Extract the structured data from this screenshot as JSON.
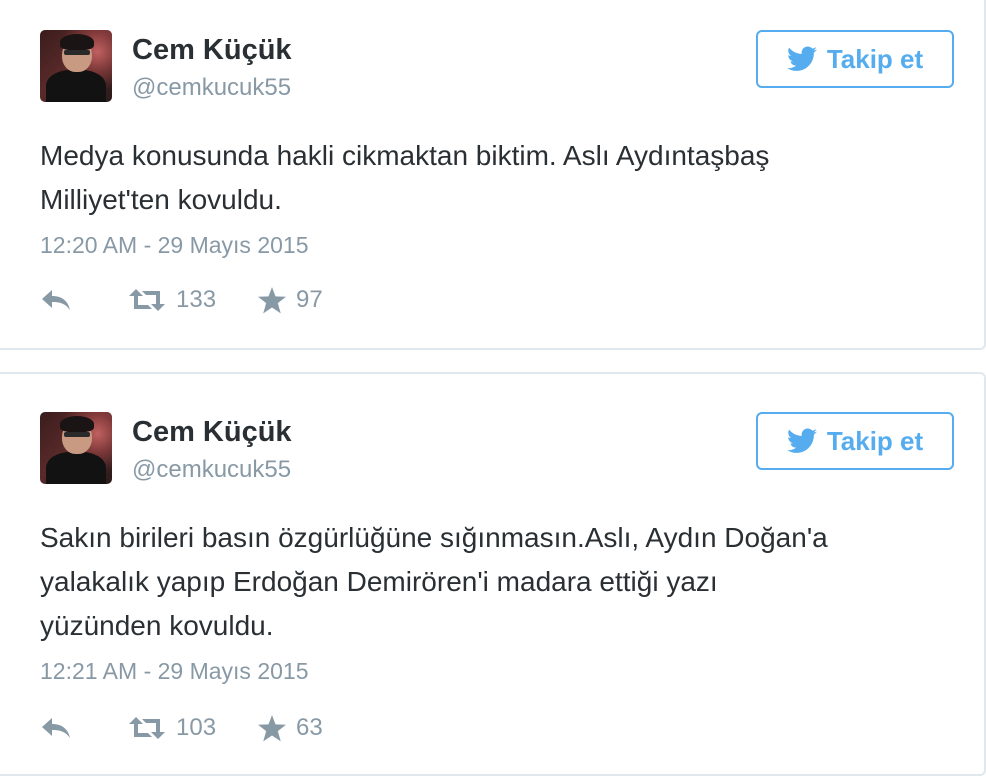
{
  "colors": {
    "accent": "#55acee",
    "text": "#292f33",
    "muted": "#8899a6",
    "border": "#e1e8ed"
  },
  "tweets": [
    {
      "name": "Cem Küçük",
      "handle": "@cemkucuk55",
      "follow_label": "Takip et",
      "text_lines": [
        "Medya konusunda hakli cikmaktan biktim. Aslı Aydıntaşbaş",
        "Milliyet'ten kovuldu."
      ],
      "timestamp": "12:20 AM - 29 Mayıs 2015",
      "retweets": "133",
      "favorites": "97",
      "icons": {
        "follow": "twitter-bird-icon",
        "reply": "reply-icon",
        "retweet": "retweet-icon",
        "favorite": "star-icon"
      }
    },
    {
      "name": "Cem Küçük",
      "handle": "@cemkucuk55",
      "follow_label": "Takip et",
      "text_lines": [
        "Sakın birileri basın özgürlüğüne sığınmasın.Aslı, Aydın Doğan'a",
        "yalakalık yapıp Erdoğan Demirören'i madara ettiği yazı",
        "yüzünden kovuldu."
      ],
      "timestamp": "12:21 AM - 29 Mayıs 2015",
      "retweets": "103",
      "favorites": "63",
      "icons": {
        "follow": "twitter-bird-icon",
        "reply": "reply-icon",
        "retweet": "retweet-icon",
        "favorite": "star-icon"
      }
    }
  ]
}
